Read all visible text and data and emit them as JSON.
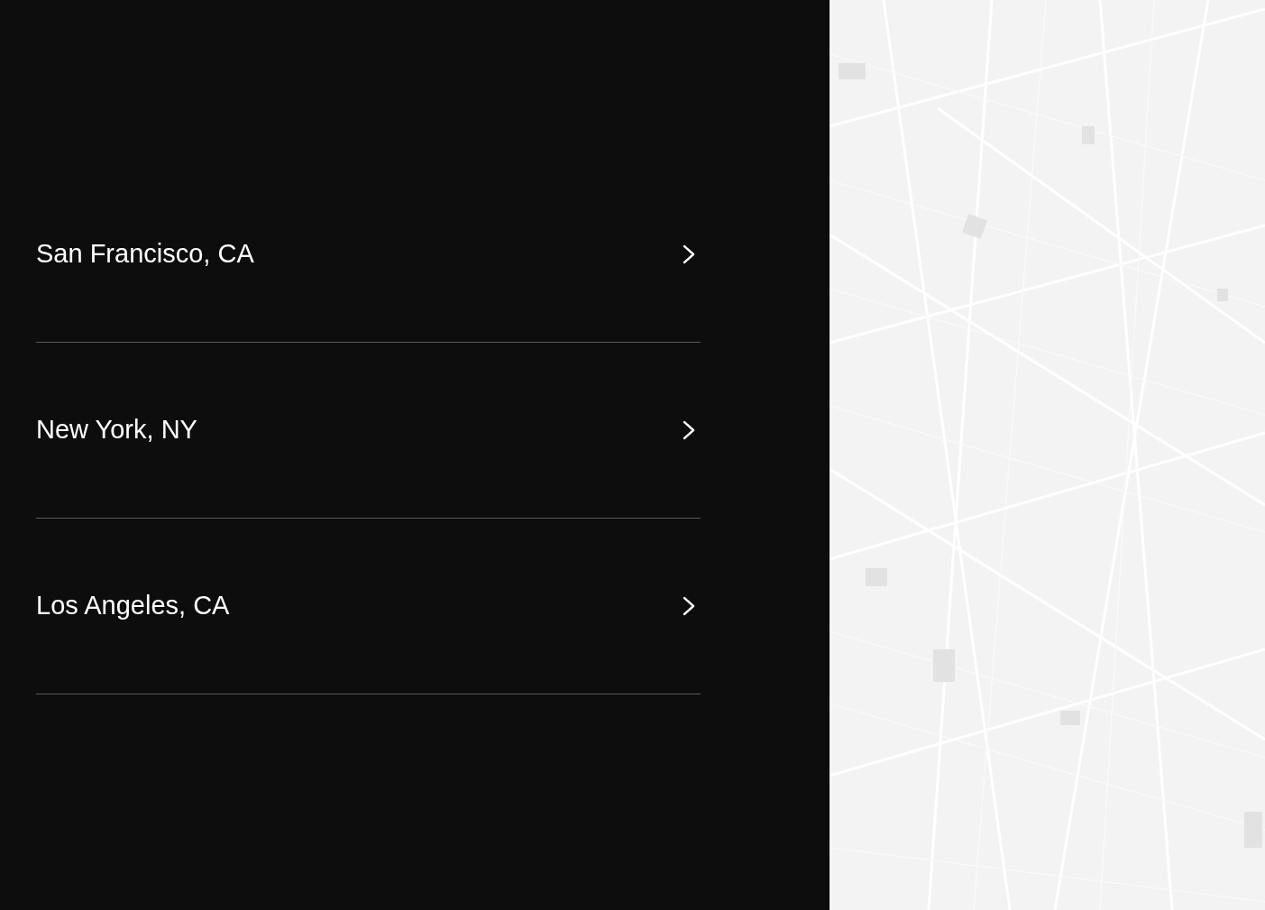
{
  "cities": [
    {
      "label": "San Francisco, CA"
    },
    {
      "label": "New York, NY"
    },
    {
      "label": "Los Angeles, CA"
    }
  ]
}
